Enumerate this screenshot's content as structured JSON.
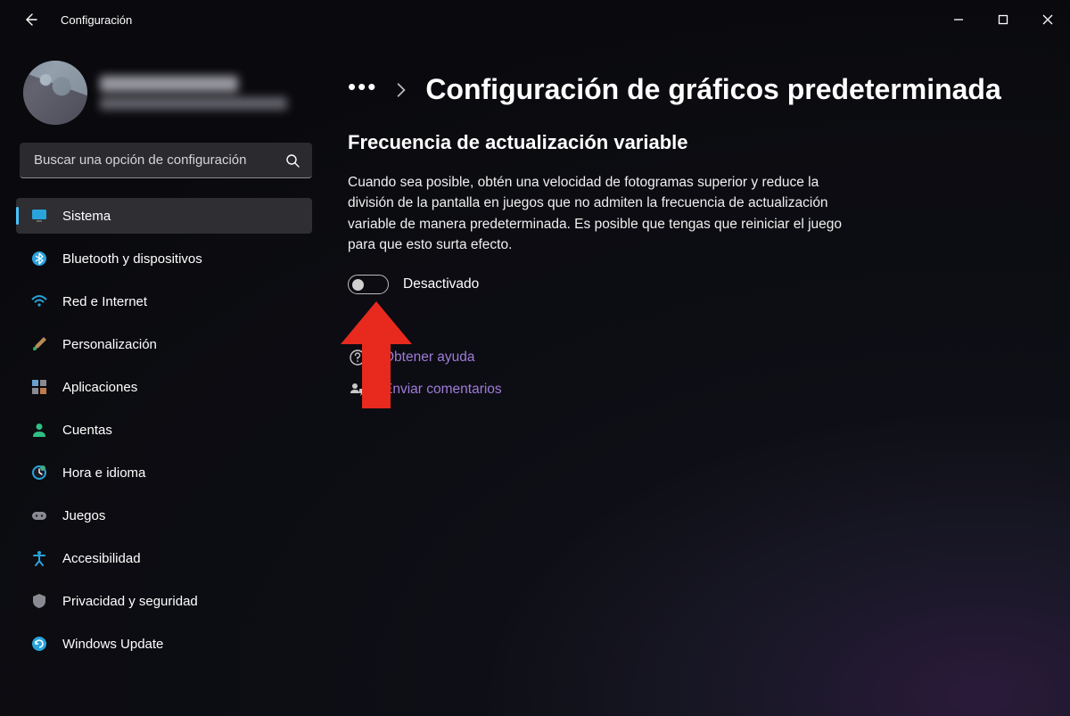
{
  "app_title": "Configuración",
  "search": {
    "placeholder": "Buscar una opción de configuración"
  },
  "sidebar": {
    "items": [
      {
        "label": "Sistema",
        "icon": "monitor-icon",
        "color": "#2aa3dc",
        "active": true
      },
      {
        "label": "Bluetooth y dispositivos",
        "icon": "bluetooth-icon",
        "color": "#2aa3dc"
      },
      {
        "label": "Red e Internet",
        "icon": "wifi-icon",
        "color": "#2aa3dc"
      },
      {
        "label": "Personalización",
        "icon": "brush-icon",
        "color": "#b88a56"
      },
      {
        "label": "Aplicaciones",
        "icon": "apps-icon",
        "color": "#8a8a92"
      },
      {
        "label": "Cuentas",
        "icon": "person-icon",
        "color": "#2fbf84"
      },
      {
        "label": "Hora e idioma",
        "icon": "clock-icon",
        "color": "#2aa3dc"
      },
      {
        "label": "Juegos",
        "icon": "gamepad-icon",
        "color": "#8a8a92"
      },
      {
        "label": "Accesibilidad",
        "icon": "accessibility-icon",
        "color": "#2aa3dc"
      },
      {
        "label": "Privacidad y seguridad",
        "icon": "shield-icon",
        "color": "#8a8a92"
      },
      {
        "label": "Windows Update",
        "icon": "update-icon",
        "color": "#2aa3dc"
      }
    ]
  },
  "breadcrumb": {
    "title": "Configuración de gráficos predeterminada"
  },
  "section": {
    "heading": "Frecuencia de actualización variable",
    "description": "Cuando sea posible, obtén una velocidad de fotogramas superior y reduce la división de la pantalla en juegos que no admiten la frecuencia de actualización variable de manera predeterminada. Es posible que tengas que reiniciar el juego para que esto surta efecto.",
    "toggle_state_label": "Desactivado"
  },
  "links": {
    "help": "Obtener ayuda",
    "feedback": "Enviar comentarios"
  }
}
